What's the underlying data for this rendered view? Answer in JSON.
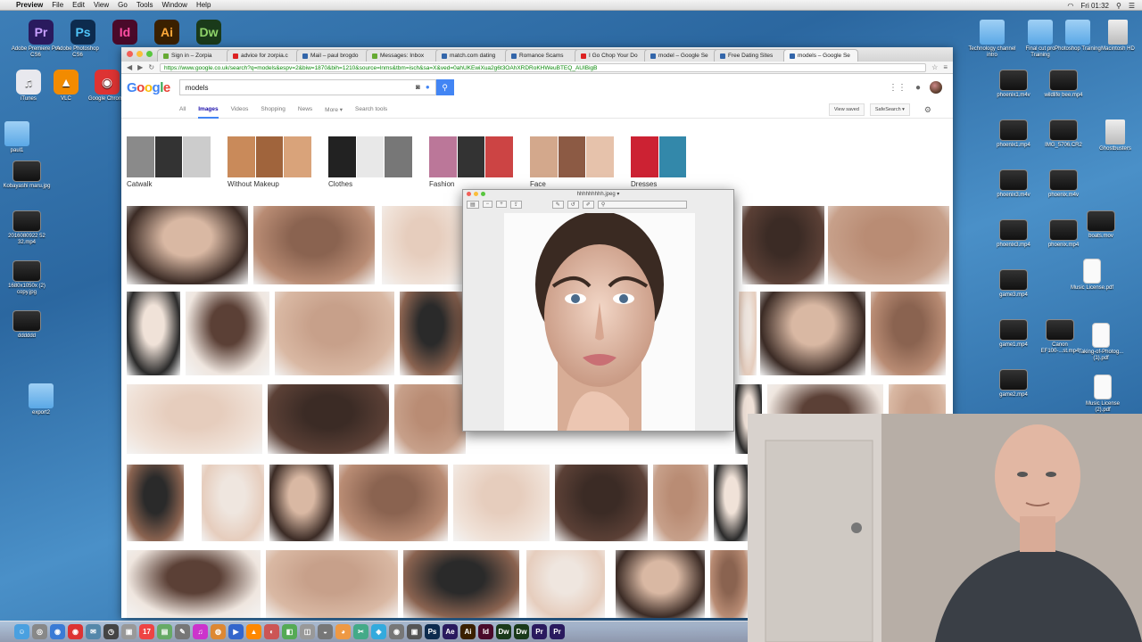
{
  "menubar": {
    "app": "Preview",
    "items": [
      "File",
      "Edit",
      "View",
      "Go",
      "Tools",
      "Window",
      "Help"
    ],
    "clock": "Fri 01:32"
  },
  "desktop_left": [
    {
      "label": "Adobe Premiere Pro CS6",
      "color": "#2a1a5e",
      "glyph": "Pr"
    },
    {
      "label": "Adobe Photoshop CS6",
      "color": "#0d2b4e",
      "glyph": "Ps"
    },
    {
      "label": "iTunes",
      "color": "#e8e8ee",
      "glyph": "♫"
    },
    {
      "label": "VLC",
      "color": "#f28b00",
      "glyph": "▲"
    },
    {
      "label": "Google Chrome",
      "color": "#d33",
      "glyph": "◉"
    },
    {
      "label": "paul1",
      "type": "folder"
    },
    {
      "label": "Kobayashi maru.jpg",
      "type": "video"
    },
    {
      "label": "2016080922 52 32.mp4",
      "type": "video"
    },
    {
      "label": "1680x1050x (2) copy.jpg",
      "type": "video"
    },
    {
      "label": "dddddd",
      "type": "video"
    },
    {
      "label": "export2",
      "type": "folder"
    }
  ],
  "desktop_right": [
    {
      "label": "Technology channel intro",
      "type": "folder"
    },
    {
      "label": "Final cut pro Training",
      "type": "folder"
    },
    {
      "label": "Photoshop Training",
      "type": "folder"
    },
    {
      "label": "Macintosh HD",
      "type": "file"
    },
    {
      "label": "phoenix1.m4v",
      "type": "video"
    },
    {
      "label": "wildlife bee.mp4",
      "type": "video"
    },
    {
      "label": "phoenix1.mp4",
      "type": "video"
    },
    {
      "label": "IMG_5706.CR2",
      "type": "video"
    },
    {
      "label": "Ghostbusters",
      "type": "file"
    },
    {
      "label": "phoenix3.m4v",
      "type": "video"
    },
    {
      "label": "phoenix.m4v",
      "type": "video"
    },
    {
      "label": "boats.mov",
      "type": "video"
    },
    {
      "label": "phoenix3.mp4",
      "type": "video"
    },
    {
      "label": "phoenix.mp4",
      "type": "video"
    },
    {
      "label": "Music License.pdf",
      "type": "pdf"
    },
    {
      "label": "game3.mp4",
      "type": "video"
    },
    {
      "label": "game1.mp4",
      "type": "video"
    },
    {
      "label": "Canon EF100-...st.mp4",
      "type": "video"
    },
    {
      "label": "Taking-of-Photog...(1).pdf",
      "type": "pdf"
    },
    {
      "label": "game2.mp4",
      "type": "video"
    },
    {
      "label": "Music License (2).pdf",
      "type": "pdf"
    }
  ],
  "top_apps": [
    "Pr",
    "Ps",
    "Id",
    "Ai",
    "Dw"
  ],
  "browser": {
    "tabs": [
      {
        "label": "Sign in – Zorpia",
        "color": "#6a3"
      },
      {
        "label": "advice for zorpia.c",
        "color": "#d22"
      },
      {
        "label": "Mail – paul brogdo",
        "color": "#36a"
      },
      {
        "label": "Messages: Inbox",
        "color": "#6a3"
      },
      {
        "label": "match.com dating",
        "color": "#36a"
      },
      {
        "label": "Romance Scams",
        "color": "#36a"
      },
      {
        "label": "I Go Chop Your Do",
        "color": "#d22"
      },
      {
        "label": "model – Google Se",
        "color": "#36a"
      },
      {
        "label": "Free Dating Sites",
        "color": "#36a"
      },
      {
        "label": "models – Google Se",
        "color": "#36a",
        "active": true
      }
    ],
    "url": "https://www.google.co.uk/search?q=models&espv=2&biw=1870&bih=1210&source=lnms&tbm=isch&sa=X&ved=0ahUKEwiXua2g6t3OAhXRDRoKHWeuBTEQ_AUIBigB",
    "logo": "Google",
    "query": "models",
    "nav": [
      {
        "label": "All"
      },
      {
        "label": "Images",
        "active": true
      },
      {
        "label": "Videos"
      },
      {
        "label": "Shopping"
      },
      {
        "label": "News"
      },
      {
        "label": "More ▾"
      },
      {
        "label": "Search tools"
      }
    ],
    "view_saved": "View saved",
    "safesearch": "SafeSearch ▾",
    "chips": [
      {
        "label": "Catwalk",
        "colors": [
          "#8a8a8a",
          "#333",
          "#ccc"
        ]
      },
      {
        "label": "Without Makeup",
        "colors": [
          "#c98a5a",
          "#a0643c",
          "#d9a37a"
        ]
      },
      {
        "label": "Clothes",
        "colors": [
          "#222",
          "#e8e8e8",
          "#777"
        ]
      },
      {
        "label": "Fashion",
        "colors": [
          "#b79",
          "#333",
          "#c44"
        ]
      },
      {
        "label": "Face",
        "colors": [
          "#d3a88c",
          "#8c5a44",
          "#e6c2ab"
        ]
      },
      {
        "label": "Dresses",
        "colors": [
          "#c23",
          "#38a",
          "#fff"
        ]
      }
    ]
  },
  "preview": {
    "title": "hhhhhhhhh.jpeg ▾"
  },
  "dock": [
    {
      "g": "☺",
      "c": "#4aa0e0"
    },
    {
      "g": "◎",
      "c": "#888"
    },
    {
      "g": "◉",
      "c": "#3a7bd5"
    },
    {
      "g": "◉",
      "c": "#d33"
    },
    {
      "g": "✉",
      "c": "#58a"
    },
    {
      "g": "◷",
      "c": "#444"
    },
    {
      "g": "▣",
      "c": "#999"
    },
    {
      "g": "17",
      "c": "#e44"
    },
    {
      "g": "▤",
      "c": "#6a6"
    },
    {
      "g": "✎",
      "c": "#777"
    },
    {
      "g": "♫",
      "c": "#c3c"
    },
    {
      "g": "◍",
      "c": "#d83"
    },
    {
      "g": "▶",
      "c": "#36c"
    },
    {
      "g": "▲",
      "c": "#f80"
    },
    {
      "g": "◐",
      "c": "#c55"
    },
    {
      "g": "◧",
      "c": "#5a5"
    },
    {
      "g": "◫",
      "c": "#999"
    },
    {
      "g": "◒",
      "c": "#777"
    },
    {
      "g": "◕",
      "c": "#e94"
    },
    {
      "g": "✂",
      "c": "#4a8"
    },
    {
      "g": "◈",
      "c": "#3ad"
    },
    {
      "g": "◉",
      "c": "#777"
    },
    {
      "g": "▣",
      "c": "#555"
    },
    {
      "g": "Ps",
      "c": "#0d2b4e"
    },
    {
      "g": "Ae",
      "c": "#2a1a5e"
    },
    {
      "g": "Ai",
      "c": "#3a2000"
    },
    {
      "g": "Id",
      "c": "#4a0a2a"
    },
    {
      "g": "Dw",
      "c": "#1a3a1a"
    },
    {
      "g": "Dw",
      "c": "#1a3a1a"
    },
    {
      "g": "Pr",
      "c": "#2a1a5e"
    },
    {
      "g": "Pr",
      "c": "#2a1a5e"
    }
  ]
}
